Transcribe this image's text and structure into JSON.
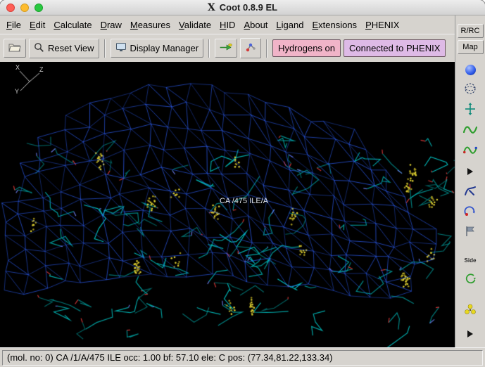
{
  "window": {
    "title": "Coot 0.8.9 EL"
  },
  "menu": {
    "items": [
      "File",
      "Edit",
      "Calculate",
      "Draw",
      "Measures",
      "Validate",
      "HID",
      "About",
      "Ligand",
      "Extensions",
      "PHENIX"
    ]
  },
  "toolbar": {
    "reset_view_label": "Reset View",
    "display_manager_label": "Display Manager",
    "hydrogens_label": "Hydrogens on",
    "phenix_label": "Connected to PHENIX",
    "hydrogens_bg": "#f0b4c8",
    "phenix_bg": "#debae6",
    "icons": [
      "open-folder-icon",
      "magnifier-icon",
      "monitor-icon",
      "go-to-atom-arrow-icon",
      "ball-stick-icon"
    ]
  },
  "right_panel": {
    "rrc_label": "R/RC",
    "map_label": "Map",
    "side_label": "Side",
    "icons": [
      "sphere-icon",
      "dashed-globe-icon",
      "crosshair-arrows-icon",
      "green-squiggle-icon",
      "green-squiggle-dots-icon",
      "right-triangle-icon",
      "blue-curve-icon",
      "curved-arrow-icon",
      "gray-flag-icon",
      "side-label",
      "circular-arrow-icon",
      "yellow-trefoil-icon",
      "right-triangle-icon"
    ]
  },
  "canvas": {
    "atom_label": "CA /475 ILE/A",
    "axes": {
      "x": "X",
      "y": "Y",
      "z": "Z"
    },
    "colors": {
      "background": "#000000",
      "mesh": "#2d5ef5",
      "sticks": "#00b7b7",
      "dots": "#d8ca30"
    }
  },
  "statusbar": {
    "text": "(mol. no: 0)  CA /1/A/475 ILE occ:  1.00 bf: 57.10 ele:  C pos: (77.34,81.22,133.34)"
  }
}
